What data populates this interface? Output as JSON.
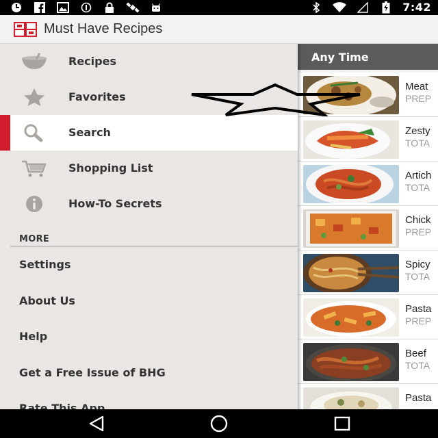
{
  "status_bar": {
    "time": "7:42",
    "left_icons": [
      "clock-icon",
      "facebook-icon",
      "gallery-icon",
      "sync-icon",
      "lock-icon",
      "satellite-icon",
      "android-icon"
    ],
    "right_icons": [
      "bluetooth-icon",
      "wifi-icon",
      "no-signal-icon",
      "battery-charging-icon"
    ]
  },
  "app_bar": {
    "title": "Must Have Recipes",
    "logo_color": "#d21d2f"
  },
  "drawer": {
    "items": [
      {
        "label": "Recipes",
        "icon": "bowl-icon"
      },
      {
        "label": "Favorites",
        "icon": "star-icon"
      },
      {
        "label": "Search",
        "icon": "search-icon",
        "active": true
      },
      {
        "label": "Shopping List",
        "icon": "cart-icon"
      },
      {
        "label": "How-To Secrets",
        "icon": "info-icon"
      }
    ],
    "more_header": "MORE",
    "more_items": [
      "Settings",
      "About Us",
      "Help",
      "Get a Free Issue of BHG",
      "Rate This App"
    ],
    "accent_color": "#d21d2f"
  },
  "content": {
    "header": "Any Time",
    "recipes": [
      {
        "title": "Meat",
        "meta": "PREP"
      },
      {
        "title": "Zesty",
        "meta": "TOTA"
      },
      {
        "title": "Artich",
        "meta": "TOTA"
      },
      {
        "title": "Chick",
        "meta": "PREP"
      },
      {
        "title": "Spicy",
        "meta": "TOTA"
      },
      {
        "title": "Pasta",
        "meta": "PREP"
      },
      {
        "title": "Beef",
        "meta": "TOTA"
      },
      {
        "title": "Pasta",
        "meta": ""
      }
    ]
  },
  "nav_bar": {
    "buttons": [
      "back-icon",
      "home-icon",
      "recents-icon"
    ]
  }
}
